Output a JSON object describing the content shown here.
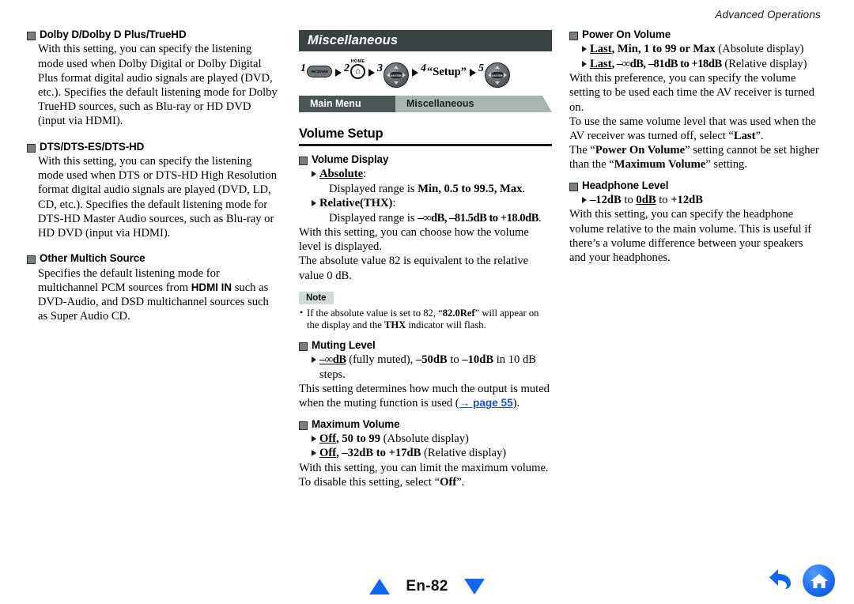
{
  "running_header": "Advanced Operations",
  "left_column": {
    "sections": [
      {
        "heading": "Dolby D/Dolby D Plus/TrueHD",
        "body": "With this setting, you can specify the listening mode used when Dolby Digital or Dolby Digital Plus format digital audio signals are played (DVD, etc.). Specifies the default listening mode for Dolby TrueHD sources, such as Blu-ray or HD DVD (input via HDMI)."
      },
      {
        "heading": "DTS/DTS-ES/DTS-HD",
        "body": "With this setting, you can specify the listening mode used when DTS or DTS-HD High Resolution format digital audio signals are played (DVD, LD, CD, etc.). Specifies the default listening mode for DTS-HD Master Audio sources, such as Blu-ray or HD DVD (input via HDMI)."
      },
      {
        "heading": "Other Multich Source",
        "body_parts": [
          "Specifies the default listening mode for multichannel PCM sources from ",
          "HDMI IN",
          " such as DVD-Audio, and DSD multichannel sources such as Super Audio CD."
        ]
      }
    ]
  },
  "mid_column": {
    "title_bar": "Miscellaneous",
    "steps": [
      {
        "num": "1",
        "icon": "receiver-button-icon",
        "label": "RECEIVER"
      },
      {
        "num": "2",
        "icon": "home-button-icon",
        "label": "HOME"
      },
      {
        "num": "3",
        "icon": "dpad-icon",
        "label": "ENTER"
      },
      {
        "num": "4",
        "icon": "text-label",
        "label": "“Setup”"
      },
      {
        "num": "5",
        "icon": "dpad-enter-icon",
        "label": "ENTER"
      }
    ],
    "breadcrumb": {
      "left": "Main Menu",
      "right": "Miscellaneous"
    },
    "section_title": "Volume Setup",
    "volume_display": {
      "heading": "Volume Display",
      "opt1_label": "Absolute",
      "opt1_suffix": ":",
      "opt1_detail_pre": "Displayed range is ",
      "opt1_detail_values": "Min, 0.5 to 99.5, Max",
      "opt1_detail_post": ".",
      "opt2_label": "Relative(THX)",
      "opt2_suffix": ":",
      "opt2_detail_pre": "Displayed range is ",
      "opt2_detail_values": "–∞dB, –81.5dB to +18.0dB",
      "opt2_detail_post": ".",
      "body1": "With this setting, you can choose how the volume level is displayed.",
      "body2": "The absolute value 82 is equivalent to the relative value 0 dB."
    },
    "note": {
      "badge": "Note",
      "text_pre": "If the absolute value is set to 82, “",
      "text_b1": "82.0Ref",
      "text_mid": "” will appear on the display and the ",
      "text_b2": "THX",
      "text_post": " indicator will flash."
    },
    "muting_level": {
      "heading": "Muting Level",
      "opt_b1": "–∞dB",
      "opt_mid1": " (fully muted), ",
      "opt_b2": "–50dB",
      "opt_mid2": " to ",
      "opt_b3": "–10dB",
      "opt_post": " in 10 dB steps.",
      "body_pre": "This setting determines how much the output is muted when the muting function is used (",
      "link": "→ page 55",
      "body_post": ")."
    },
    "maximum_volume": {
      "heading": "Maximum Volume",
      "opt1_u": "Off",
      "opt1_rest_b": ", 50 to 99",
      "opt1_rest": " (Absolute display)",
      "opt2_u": "Off",
      "opt2_rest_b": ", –32dB to +17dB",
      "opt2_rest": " (Relative display)",
      "body1": "With this setting, you can limit the maximum volume.",
      "body2_pre": "To disable this setting, select “",
      "body2_b": "Off",
      "body2_post": "”."
    }
  },
  "right_column": {
    "power_on_volume": {
      "heading": "Power On Volume",
      "opt1_u": "Last",
      "opt1_b": ", Min, 1 to 99 or Max",
      "opt1_rest": " (Absolute display)",
      "opt2_u": "Last",
      "opt2_b": ", –∞dB, –81dB to +18dB",
      "opt2_rest": " (Relative display)",
      "body1": "With this preference, you can specify the volume setting to be used each time the AV receiver is turned on.",
      "body2_pre": "To use the same volume level that was used when the AV receiver was turned off, select “",
      "body2_b": "Last",
      "body2_post": "”.",
      "body3_pre": "The “",
      "body3_b1": "Power On Volume",
      "body3_mid": "” setting cannot be set higher than the “",
      "body3_b2": "Maximum Volume",
      "body3_post": "” setting."
    },
    "headphone_level": {
      "heading": "Headphone Level",
      "opt_b1": "–12dB",
      "opt_mid": " to ",
      "opt_u": "0dB",
      "opt_mid2": " to ",
      "opt_b2": "+12dB",
      "body": "With this setting, you can specify the headphone volume relative to the main volume. This is useful if there’s a volume difference between your speakers and your headphones."
    }
  },
  "footer": {
    "page_label": "En-82",
    "prev_icon": "triangle-up-icon",
    "next_icon": "triangle-down-icon",
    "back_icon": "back-arrow-icon",
    "home_icon": "home-icon"
  },
  "colors": {
    "title_bar": "#3a4244",
    "crumb_left": "#4c5558",
    "crumb_right": "#aab5b2",
    "note_badge": "#cfdcd8",
    "link_blue": "#1c4ddb",
    "nav_blue": "#1267f2"
  }
}
